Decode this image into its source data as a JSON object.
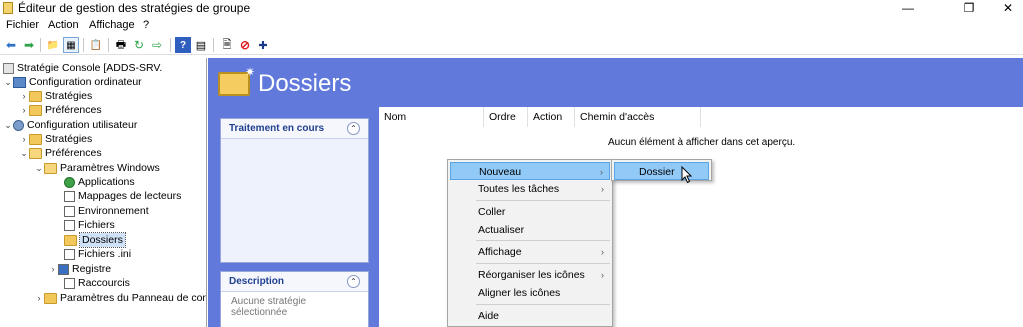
{
  "window": {
    "title": "Éditeur de gestion des stratégies de groupe",
    "controls": {
      "minimize": "—",
      "maximize": "❐",
      "close": "✕"
    }
  },
  "menu": [
    "Fichier",
    "Action",
    "Affichage",
    "?"
  ],
  "toolbar": {
    "icons": [
      "back-icon",
      "forward-icon",
      "up-folder-icon",
      "show-tree-icon",
      "properties-icon",
      "print-icon",
      "refresh-icon",
      "export-icon",
      "help-icon",
      "console-icon",
      "new-doc-icon",
      "stop-icon",
      "add-icon"
    ],
    "glyphs": [
      "⬅",
      "➡",
      "📁",
      "▦",
      "📋",
      "🖶",
      "↻",
      "⇨",
      "?",
      "▤",
      "🗎",
      "⊘",
      "✚"
    ]
  },
  "tree": {
    "root": "Stratégie Console [ADDS-SRV.",
    "computer_config": "Configuration ordinateur",
    "cc_strategies": "Stratégies",
    "cc_preferences": "Préférences",
    "user_config": "Configuration utilisateur",
    "uc_strategies": "Stratégies",
    "uc_preferences": "Préférences",
    "windows_params": "Paramètres Windows",
    "applications": "Applications",
    "drive_maps": "Mappages de lecteurs",
    "environment": "Environnement",
    "files": "Fichiers",
    "folders": "Dossiers",
    "ini_files": "Fichiers .ini",
    "registry": "Registre",
    "shortcuts": "Raccourcis",
    "control_panel": "Paramètres du Panneau de config"
  },
  "main": {
    "title": "Dossiers",
    "processing_box": {
      "title": "Traitement en cours",
      "collapse": "⌃"
    },
    "description_box": {
      "title": "Description",
      "collapse": "⌃",
      "text": "Aucune stratégie sélectionnée"
    },
    "columns": [
      "Nom",
      "Ordre",
      "Action",
      "Chemin d'accès"
    ],
    "empty_message": "Aucun élément à afficher dans cet aperçu."
  },
  "context_menu": {
    "items": {
      "new": "Nouveau",
      "all_tasks": "Toutes les tâches",
      "paste": "Coller",
      "refresh": "Actualiser",
      "view": "Affichage",
      "arrange_icons": "Réorganiser les icônes",
      "align_icons": "Aligner les icônes",
      "help": "Aide"
    },
    "submenu_arrow": "›"
  },
  "submenu": {
    "folder": "Dossier"
  },
  "colors": {
    "pane_background": "#6079db",
    "highlight": "#91c9f7"
  }
}
